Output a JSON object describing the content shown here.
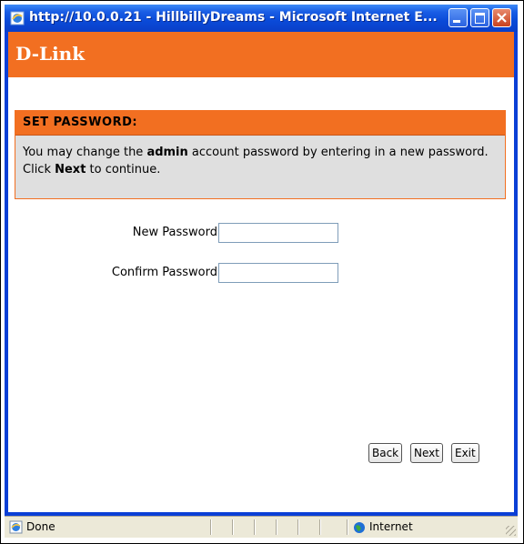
{
  "window": {
    "title": "http://10.0.0.21 - HillbillyDreams - Microsoft Internet E...",
    "controls": [
      "minimize",
      "maximize",
      "close"
    ]
  },
  "brand": {
    "logo_text": "D-Link",
    "color": "#f26f21"
  },
  "panel": {
    "heading": "SET PASSWORD:",
    "desc_part1": "You may change the ",
    "desc_bold1": "admin",
    "desc_part2": " account password by entering in a new password. Click ",
    "desc_bold2": "Next",
    "desc_part3": " to continue."
  },
  "form": {
    "new_password_label": "New Password",
    "new_password_value": "",
    "confirm_password_label": "Confirm Password",
    "confirm_password_value": ""
  },
  "buttons": {
    "back": "Back",
    "next": "Next",
    "exit": "Exit"
  },
  "statusbar": {
    "status": "Done",
    "zone": "Internet"
  }
}
